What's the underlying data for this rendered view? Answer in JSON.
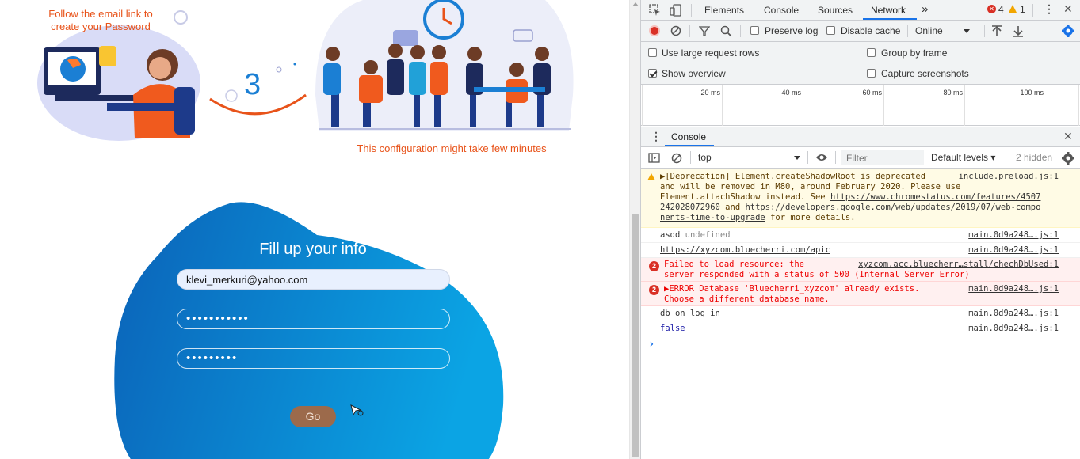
{
  "page": {
    "email_hint": "Follow the email link to create your Password",
    "step_number": "3",
    "config_hint": "This configuration might take few minutes",
    "form": {
      "title": "Fill up your info",
      "email_value": "klevi_merkuri@yahoo.com",
      "password_value": "•••••••••••",
      "confirm_value": "•••••••••",
      "go_label": "Go"
    }
  },
  "devtools": {
    "tabs": [
      "Elements",
      "Console",
      "Sources",
      "Network"
    ],
    "active_tab": "Network",
    "more_tabs": "»",
    "error_count": "4",
    "warning_count": "1",
    "toolbar": {
      "preserve_log": "Preserve log",
      "disable_cache": "Disable cache",
      "throttle": "Online"
    },
    "settings": {
      "large_rows": "Use large request rows",
      "group_by_frame": "Group by frame",
      "show_overview": "Show overview",
      "capture_screenshots": "Capture screenshots"
    },
    "timeline_ticks": [
      "20 ms",
      "40 ms",
      "60 ms",
      "80 ms",
      "100 ms"
    ],
    "drawer_tab": "Console",
    "console_toolbar": {
      "context": "top",
      "filter_placeholder": "Filter",
      "levels": "Default levels ▾",
      "hidden": "2 hidden"
    },
    "messages": [
      {
        "type": "warning",
        "text_a": "▶[Deprecation] Element.createShadowRoot is deprecated\nand will be removed in M80, around February 2020. Please use\nElement.attachShadow instead. See ",
        "link1": "https://www.chromestatus.com/features/4507\n242028072960",
        "text_b": " and ",
        "link2": "https://developers.google.com/web/updates/2019/07/web-compo\nnents-time-to-upgrade",
        "text_c": " for more details.",
        "source": "include.preload.js:1"
      },
      {
        "type": "log",
        "text": "asdd",
        "extra": "undefined",
        "source": "main.0d9a248….js:1"
      },
      {
        "type": "log",
        "text": "https://xyzcom.bluecherri.com/apic",
        "source": "main.0d9a248….js:1"
      },
      {
        "type": "error",
        "count": "2",
        "text": "Failed to load resource: the\nserver responded with a status of 500 (Internal Server Error)",
        "source": "xyzcom.acc.bluecherr…stall/chechDbUsed:1"
      },
      {
        "type": "error",
        "count": "2",
        "text": "▶ERROR Database 'Bluecherri_xyzcom' already exists.\nChoose a different database name.",
        "source": "main.0d9a248….js:1"
      },
      {
        "type": "log",
        "text": "db on log in",
        "source": "main.0d9a248….js:1"
      },
      {
        "type": "log",
        "text": "false",
        "source": "main.0d9a248….js:1"
      }
    ],
    "prompt": "›"
  }
}
